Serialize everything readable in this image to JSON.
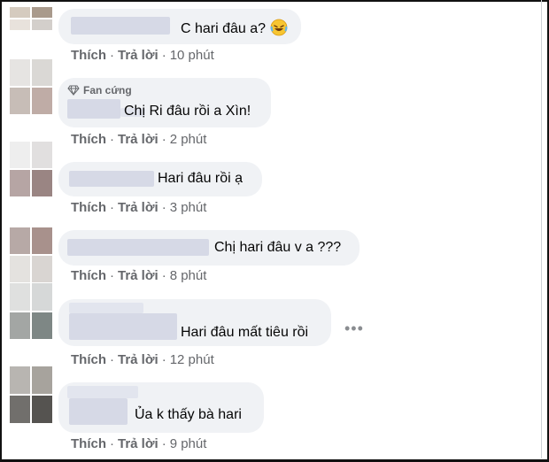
{
  "comments": [
    {
      "text": "C hari đâu a?",
      "emoji": "rolling-laughing-emoji",
      "badge": "",
      "actions": {
        "like": "Thích",
        "reply": "Trả lời",
        "time": "10 phút"
      },
      "avatar_colors": [
        "#d5cbbf",
        "#a99a8c",
        "#e8e2dc",
        "#d3cfcb"
      ]
    },
    {
      "text": "Chị Ri đâu rồi a Xìn!",
      "badge": "Fan cứng",
      "actions": {
        "like": "Thích",
        "reply": "Trả lời",
        "time": "2 phút"
      },
      "avatar_colors": [
        "#e6e4e2",
        "#dad8d5",
        "#c7bdb7",
        "#bfaca6"
      ]
    },
    {
      "text": "Hari đâu rồi ạ",
      "badge": "",
      "actions": {
        "like": "Thích",
        "reply": "Trả lời",
        "time": "3 phút"
      },
      "avatar_colors": [
        "#eeeeee",
        "#e1dfdf",
        "#b6a5a4",
        "#9a8583"
      ]
    },
    {
      "text": "Chị hari đâu v a ???",
      "badge": "",
      "actions": {
        "like": "Thích",
        "reply": "Trả lời",
        "time": "8 phút"
      },
      "avatar_colors": [
        "#b7a9a6",
        "#a8918c",
        "#e4e2df",
        "#d9d5d2"
      ]
    },
    {
      "text": "Hari đâu mất tiêu rồi",
      "badge": "",
      "actions": {
        "like": "Thích",
        "reply": "Trả lời",
        "time": "12 phút"
      },
      "avatar_colors": [
        "#dfe0df",
        "#d6d8d8",
        "#a3a6a4",
        "#7e8785"
      ]
    },
    {
      "text": "Ủa k thấy bà hari",
      "badge": "",
      "actions": {
        "like": "Thích",
        "reply": "Trả lời",
        "time": "9 phút"
      },
      "avatar_colors": [
        "#b8b5b1",
        "#a7a39d",
        "#716f6c",
        "#555350"
      ]
    }
  ],
  "more_glyph": "•••",
  "colors": {
    "bubble": "#f0f2f5",
    "meta": "#65676b",
    "text": "#050505"
  }
}
